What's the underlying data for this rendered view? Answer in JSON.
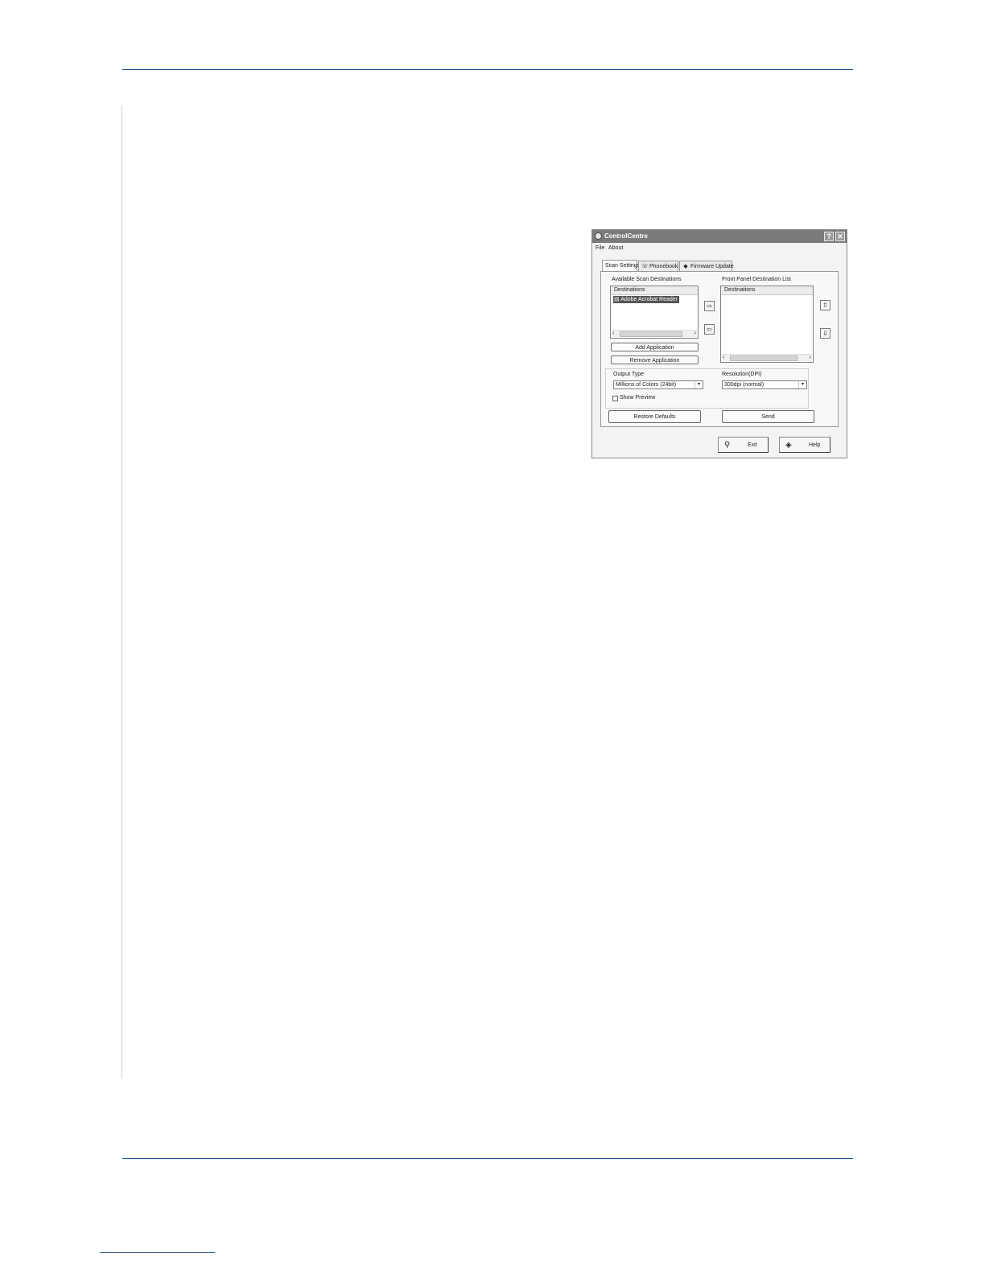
{
  "window": {
    "title": "ControlCentre",
    "help_button": "?",
    "close_button": "✕"
  },
  "menu": {
    "file": "File",
    "about": "About"
  },
  "tabs": [
    {
      "label": "Scan Settings",
      "active": true,
      "icon": ""
    },
    {
      "label": "Phonebook",
      "active": false,
      "icon": "phonebook-icon"
    },
    {
      "label": "Firmware Update",
      "active": false,
      "icon": "firmware-icon"
    }
  ],
  "scan": {
    "available_label": "Available Scan Destinations",
    "available_header": "Destinations",
    "available_items": [
      "Adobe Acrobat Reader"
    ],
    "add_application": "Add Application",
    "remove_application": "Remove Application",
    "front_label": "Front Panel Destination List",
    "front_header": "Destinations",
    "output_type_label": "Output Type",
    "output_type_value": "Millions of Colors (24bit)",
    "resolution_label": "Resolution(DPI)",
    "resolution_value": "300dpi (normal)",
    "show_preview_label": "Show Preview",
    "show_preview_checked": false,
    "restore_defaults": "Restore Defaults",
    "send": "Send"
  },
  "footer": {
    "exit": "Exit",
    "help": "Help"
  },
  "colors": {
    "page_rule": "#1f4e8c",
    "titlebar": "#7a7a7a",
    "selection": "#555555"
  }
}
